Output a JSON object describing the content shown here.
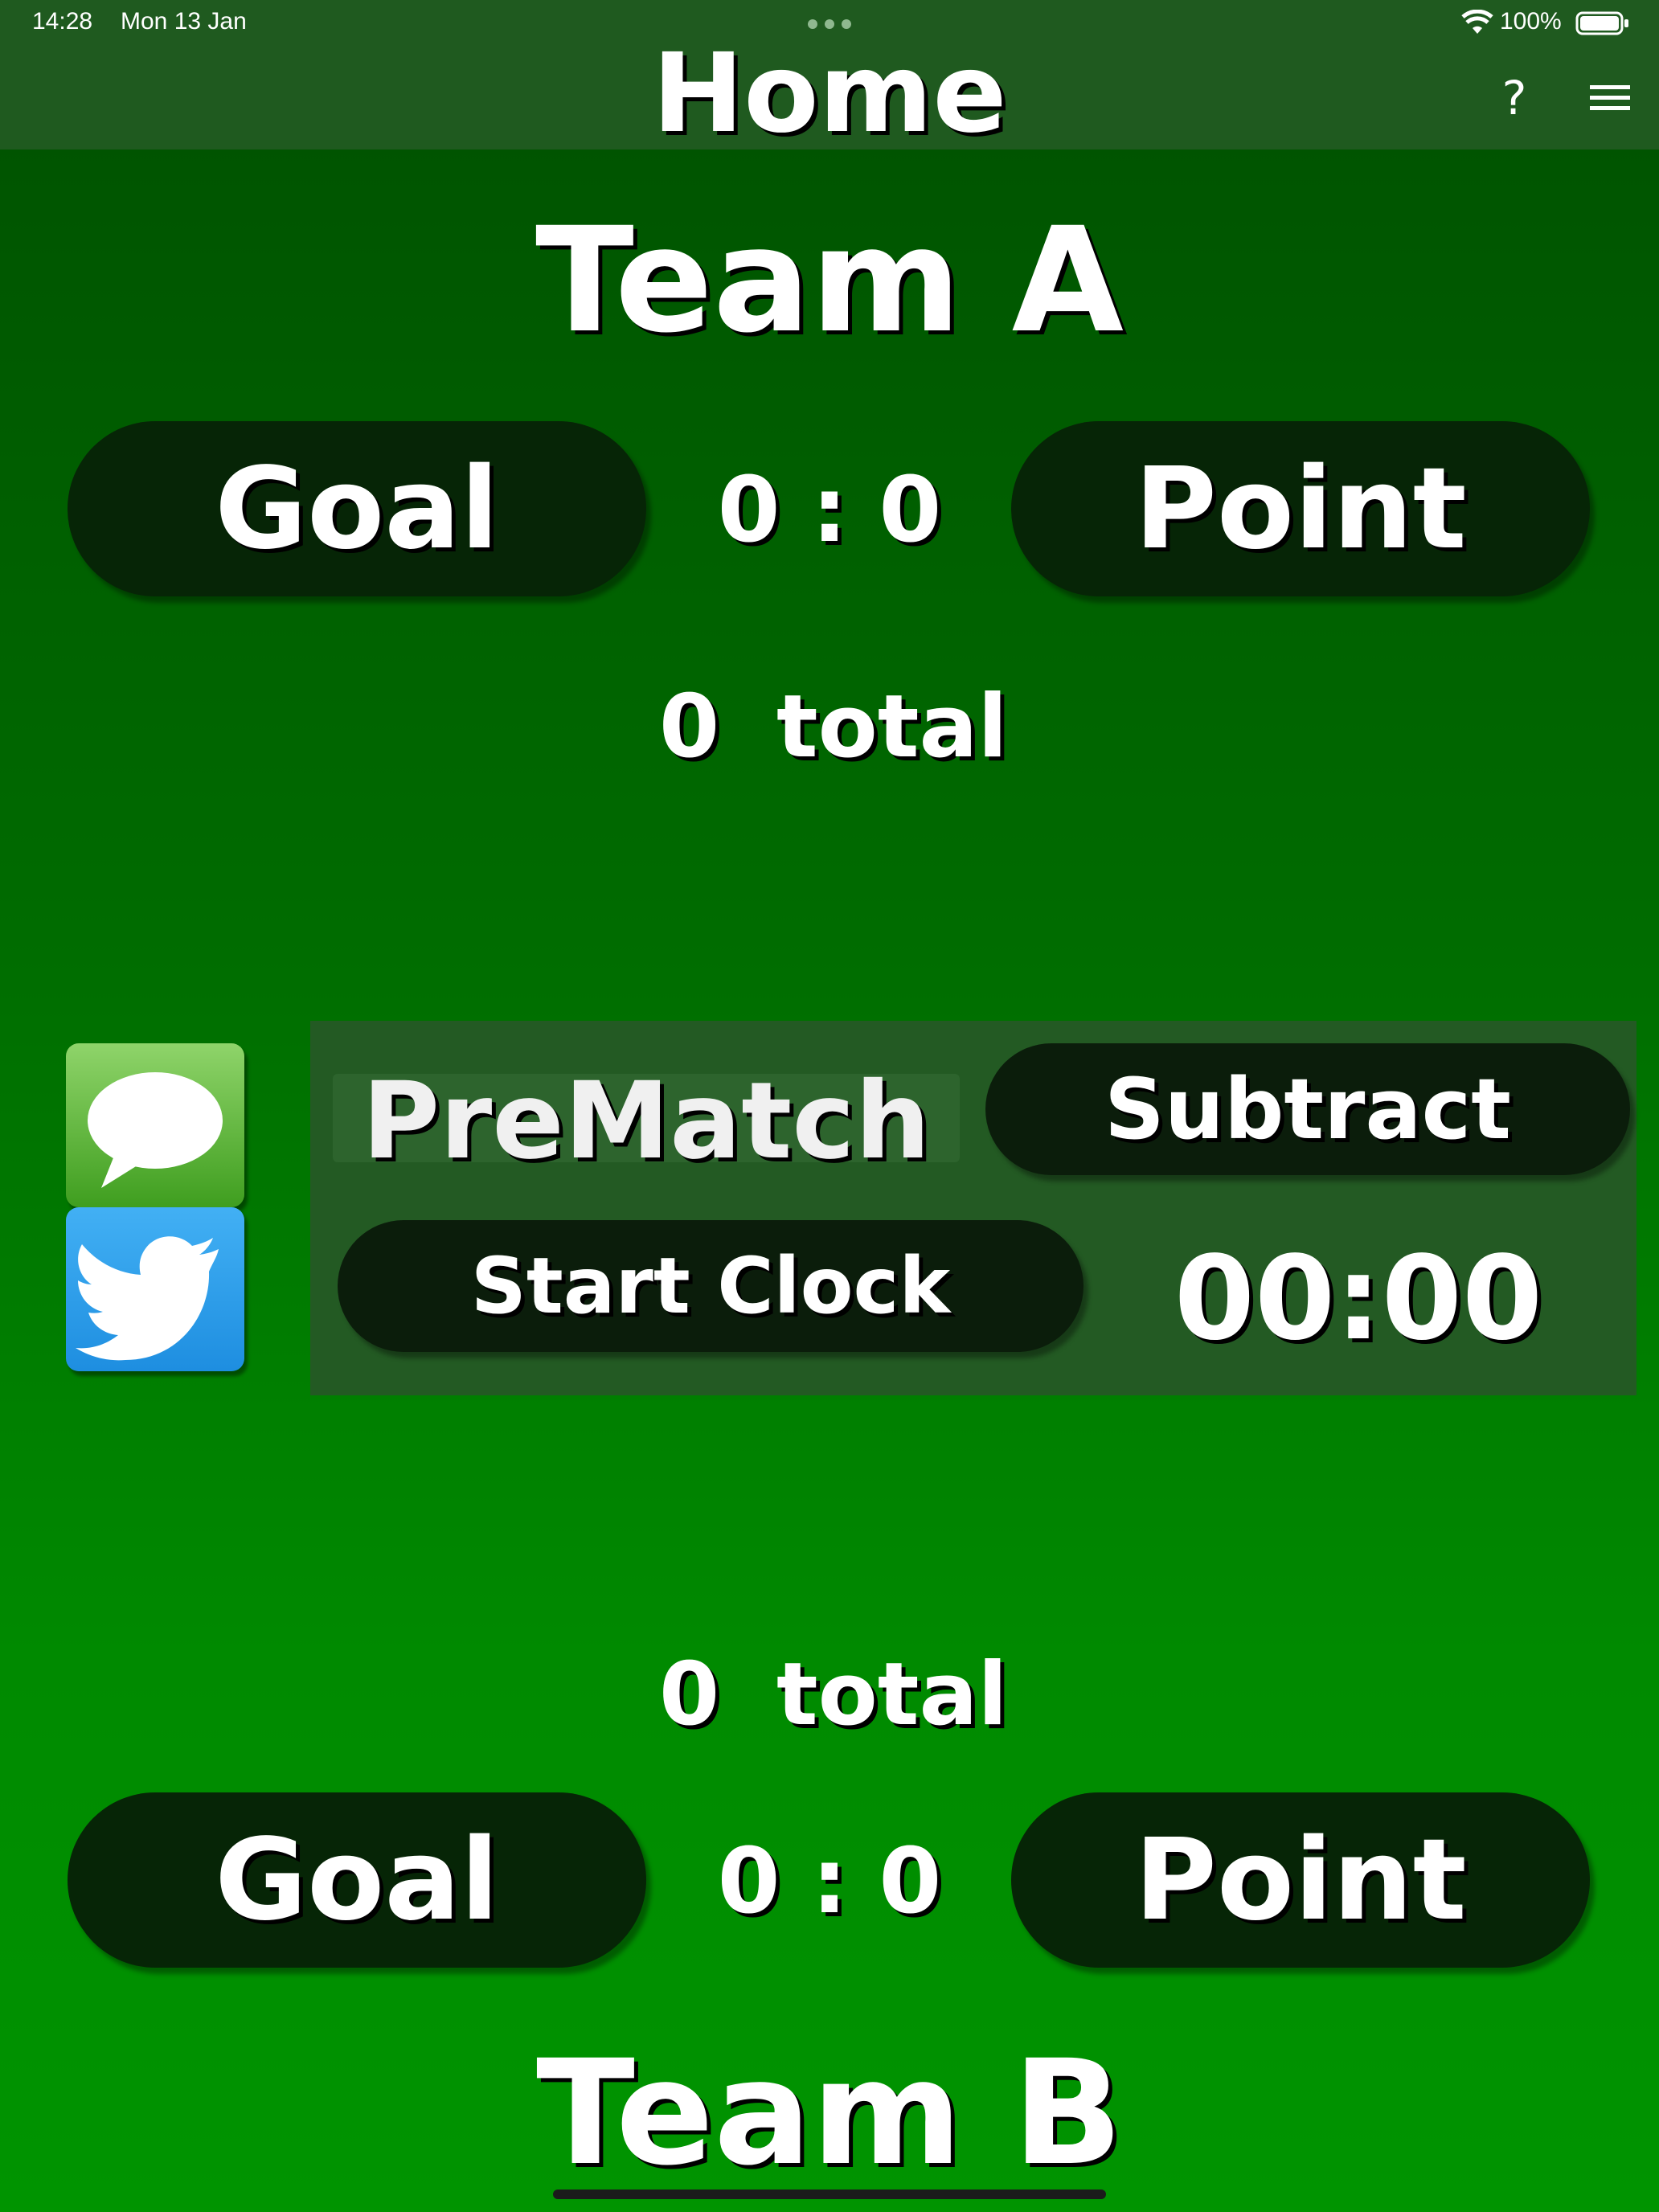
{
  "status_bar": {
    "time": "14:28",
    "date": "Mon 13 Jan",
    "battery": "100%"
  },
  "nav": {
    "title": "Home",
    "help_label": "?"
  },
  "team_a": {
    "name": "Team A",
    "goal_label": "Goal",
    "point_label": "Point",
    "score": "0 : 0",
    "total_value": "0",
    "total_label": "total"
  },
  "team_b": {
    "name": "Team B",
    "goal_label": "Goal",
    "point_label": "Point",
    "score": "0 : 0",
    "total_value": "0",
    "total_label": "total"
  },
  "match": {
    "phase": "PreMatch",
    "subtract_label": "Subtract",
    "start_clock_label": "Start Clock",
    "clock": "00:00"
  },
  "colors": {
    "nav_bg": "#1f5a1f",
    "panel_bg": "#235a23",
    "pill_bg": "#062506",
    "bg_top": "#005000",
    "bg_bottom": "#009400"
  },
  "share_icons": [
    "messages-icon",
    "twitter-icon"
  ]
}
